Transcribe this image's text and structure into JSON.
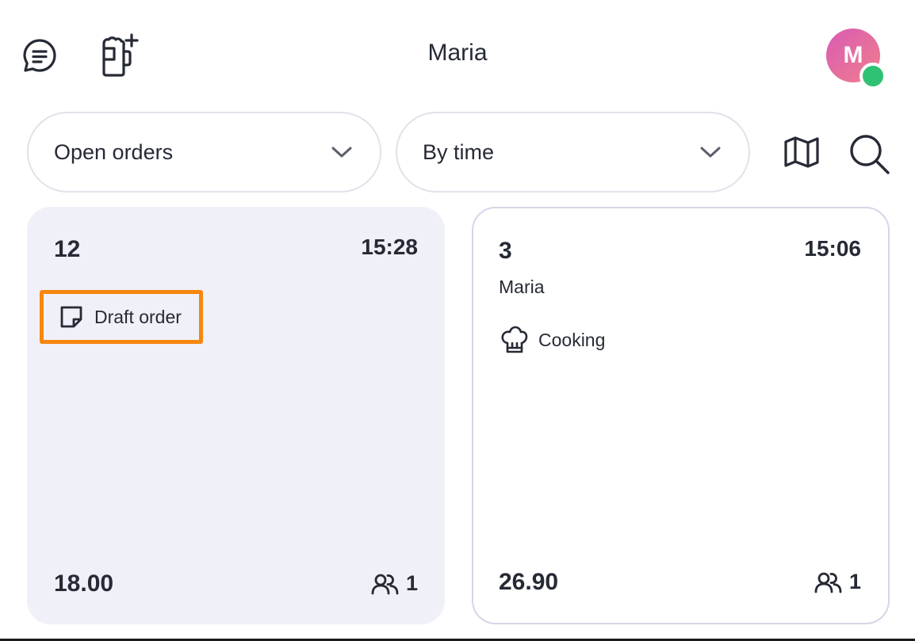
{
  "header": {
    "title": "Maria",
    "avatar_initial": "M",
    "icons": {
      "chat": "chat-icon",
      "new_order": "beer-mug-plus-icon"
    }
  },
  "filters": {
    "order_filter": {
      "value": "Open orders"
    },
    "sort": {
      "value": "By time"
    },
    "icons": {
      "map": "map-icon",
      "search": "search-icon"
    }
  },
  "orders": [
    {
      "table": "12",
      "time": "15:28",
      "waiter": "",
      "status": "Draft order",
      "status_icon": "note-icon",
      "total": "18.00",
      "guests": "1",
      "selected": true
    },
    {
      "table": "3",
      "time": "15:06",
      "waiter": "Maria",
      "status": "Cooking",
      "status_icon": "chef-hat-icon",
      "total": "26.90",
      "guests": "1",
      "selected": false
    }
  ],
  "colors": {
    "accent": "#f7870f",
    "selected_card_bg": "#f0f0f8",
    "presence_online": "#2fc274",
    "avatar_gradient_start": "#d95bb4",
    "avatar_gradient_end": "#f07e8c"
  }
}
